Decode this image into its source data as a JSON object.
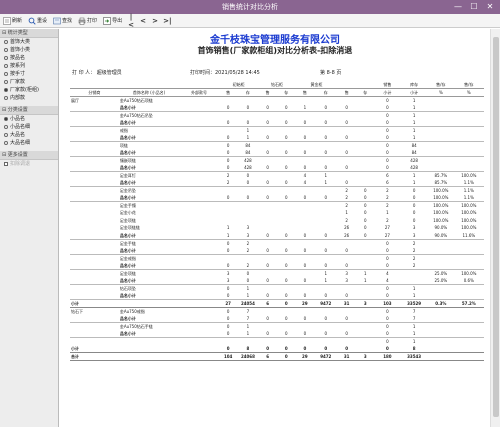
{
  "window": {
    "title": "销售统计对比分析",
    "min": "—",
    "max": "☐",
    "close": "✕"
  },
  "toolbar": {
    "refresh": "刷新",
    "reset": "重设",
    "search": "查找",
    "print": "打印",
    "export": "导出"
  },
  "sidebar": {
    "stat_type": {
      "title": "统计类型",
      "options": [
        "首饰大类",
        "首饰小类",
        "按品名",
        "按系列",
        "按手寸",
        "厂家款",
        "厂家款(柜组)",
        "内部款"
      ],
      "selected": 6
    },
    "group": {
      "title": "分类设置",
      "options": [
        "小品名",
        "小品名细",
        "大品名",
        "大品名细"
      ],
      "selected": 0
    },
    "more": {
      "title": "更多设置",
      "options": [
        "扣除调退"
      ]
    }
  },
  "report": {
    "company": "金千枝珠宝管理服务有限公司",
    "title": "首饰销售(厂家款柜组)对比分析表-扣除消退",
    "printer": "打 印 人： 超级管理员",
    "print_time": "打印时间：2021/05/28 14:45",
    "page": "第 8-8 页"
  },
  "table": {
    "groups": [
      "",
      "",
      "",
      "",
      "初始柜",
      "",
      "钻石柜",
      "",
      "黄金柜",
      "",
      "销售",
      "库存",
      "售/存",
      "售/存"
    ],
    "sub": [
      "分销商",
      "首饰名称\n(小品名)",
      "外部款号",
      "售",
      "存",
      "售",
      "存",
      "售",
      "存",
      "售",
      "存",
      "小计",
      "小计",
      "%",
      "%"
    ],
    "rows": [
      [
        "展厅",
        "金Au750钻石项链",
        "",
        "",
        "",
        "",
        "",
        "",
        "",
        "",
        "",
        "0",
        "1",
        "",
        ""
      ],
      [
        "",
        "品名小计",
        "",
        "0",
        "0",
        "0",
        "0",
        "1",
        "0",
        "0",
        "",
        "0",
        "1",
        "",
        ""
      ],
      [
        "",
        "金Au750钻石吊坠",
        "",
        "",
        "",
        "",
        "",
        "",
        "",
        "",
        "",
        "0",
        "1",
        "",
        ""
      ],
      [
        "",
        "品名小计",
        "",
        "0",
        "0",
        "0",
        "0",
        "0",
        "0",
        "0",
        "",
        "0",
        "1",
        "",
        ""
      ],
      [
        "",
        "戒指",
        "",
        "",
        "1",
        "",
        "",
        "",
        "",
        "",
        "",
        "0",
        "1",
        "",
        ""
      ],
      [
        "",
        "品名小计",
        "",
        "0",
        "1",
        "0",
        "0",
        "0",
        "0",
        "0",
        "",
        "0",
        "1",
        "",
        ""
      ],
      [
        "",
        "项链",
        "",
        "0",
        "84",
        "",
        "",
        "",
        "",
        "",
        "",
        "0",
        "84",
        "",
        ""
      ],
      [
        "",
        "品名小计",
        "",
        "0",
        "84",
        "0",
        "0",
        "0",
        "0",
        "0",
        "",
        "0",
        "84",
        "",
        ""
      ],
      [
        "",
        "镶嵌项链",
        "",
        "0",
        "428",
        "",
        "",
        "",
        "",
        "",
        "",
        "0",
        "428",
        "",
        ""
      ],
      [
        "",
        "品名小计",
        "",
        "0",
        "428",
        "0",
        "0",
        "0",
        "0",
        "0",
        "",
        "0",
        "428",
        "",
        ""
      ],
      [
        "",
        "足金耳钉",
        "",
        "2",
        "0",
        "",
        "",
        "4",
        "1",
        "",
        "",
        "6",
        "1",
        "85.7%",
        "100.0%"
      ],
      [
        "",
        "品名小计",
        "",
        "2",
        "0",
        "0",
        "0",
        "4",
        "1",
        "0",
        "",
        "6",
        "1",
        "85.7%",
        "1.1%"
      ],
      [
        "",
        "足金吊坠",
        "",
        "",
        "",
        "",
        "",
        "",
        "",
        "2",
        "0",
        "2",
        "0",
        "100.0%",
        "1.1%"
      ],
      [
        "",
        "品名小计",
        "",
        "0",
        "0",
        "0",
        "0",
        "0",
        "0",
        "2",
        "0",
        "2",
        "0",
        "100.0%",
        "1.1%"
      ],
      [
        "",
        "足金手镯",
        "",
        "",
        "",
        "",
        "",
        "",
        "",
        "2",
        "0",
        "2",
        "0",
        "100.0%",
        "100.0%"
      ],
      [
        "",
        "足金小花",
        "",
        "",
        "",
        "",
        "",
        "",
        "",
        "1",
        "0",
        "1",
        "0",
        "100.0%",
        "100.0%"
      ],
      [
        "",
        "足金项链",
        "",
        "",
        "",
        "",
        "",
        "",
        "",
        "2",
        "0",
        "2",
        "0",
        "100.0%",
        "100.0%"
      ],
      [
        "",
        "足金项链链",
        "",
        "1",
        "3",
        "",
        "",
        "",
        "",
        "26",
        "0",
        "27",
        "3",
        "90.0%",
        "100.0%"
      ],
      [
        "",
        "品名小计",
        "",
        "1",
        "3",
        "0",
        "0",
        "0",
        "0",
        "26",
        "0",
        "27",
        "3",
        "90.0%",
        "11.6%"
      ],
      [
        "",
        "足金手链",
        "",
        "0",
        "2",
        "",
        "",
        "",
        "",
        "",
        "",
        "0",
        "2",
        "",
        ""
      ],
      [
        "",
        "品名小计",
        "",
        "0",
        "2",
        "0",
        "0",
        "0",
        "0",
        "0",
        "",
        "0",
        "2",
        "",
        ""
      ],
      [
        "",
        "足金戒指",
        "",
        "",
        "",
        "",
        "",
        "",
        "",
        "",
        "",
        "0",
        "2",
        "",
        ""
      ],
      [
        "",
        "品名小计",
        "",
        "0",
        "2",
        "0",
        "0",
        "0",
        "0",
        "0",
        "",
        "0",
        "2",
        "",
        ""
      ],
      [
        "",
        "足金项链",
        "",
        "3",
        "0",
        "",
        "",
        "",
        "1",
        "3",
        "1",
        "4",
        "",
        "25.0%",
        "100.0%"
      ],
      [
        "",
        "品名小计",
        "",
        "3",
        "0",
        "0",
        "0",
        "0",
        "1",
        "3",
        "1",
        "4",
        "",
        "25.0%",
        "0.6%"
      ],
      [
        "",
        "钻石项坠",
        "",
        "0",
        "1",
        "",
        "",
        "",
        "",
        "",
        "",
        "0",
        "1",
        "",
        ""
      ],
      [
        "",
        "品名小计",
        "",
        "0",
        "1",
        "0",
        "0",
        "0",
        "0",
        "0",
        "",
        "0",
        "1",
        "",
        ""
      ],
      [
        "小计",
        "",
        "",
        "27",
        "24054",
        "6",
        "0",
        "29",
        "9472",
        "31",
        "3",
        "103",
        "33529",
        "0.3%",
        "57.2%"
      ],
      [
        "钻石下",
        "金Au750戒指",
        "",
        "0",
        "7",
        "",
        "",
        "",
        "",
        "",
        "",
        "0",
        "7",
        "",
        ""
      ],
      [
        "",
        "品名小计",
        "",
        "0",
        "7",
        "0",
        "0",
        "0",
        "0",
        "0",
        "",
        "0",
        "7",
        "",
        ""
      ],
      [
        "",
        "金Au750钻石手链",
        "",
        "0",
        "1",
        "",
        "",
        "",
        "",
        "",
        "",
        "0",
        "1",
        "",
        ""
      ],
      [
        "",
        "品名小计",
        "",
        "0",
        "1",
        "0",
        "0",
        "0",
        "0",
        "0",
        "",
        "0",
        "1",
        "",
        ""
      ],
      [
        "",
        "",
        "",
        "",
        "",
        "",
        "",
        "",
        "",
        "",
        "",
        "0",
        "1",
        "",
        ""
      ],
      [
        "小计",
        "",
        "",
        "0",
        "8",
        "0",
        "0",
        "0",
        "0",
        "0",
        "",
        "0",
        "8",
        "",
        ""
      ],
      [
        "合计",
        "",
        "",
        "104",
        "24068",
        "6",
        "0",
        "29",
        "9472",
        "31",
        "3",
        "180",
        "33543",
        "",
        ""
      ]
    ]
  },
  "colors": {
    "titlebar": "#8a6591",
    "company": "#1a3ad0"
  }
}
